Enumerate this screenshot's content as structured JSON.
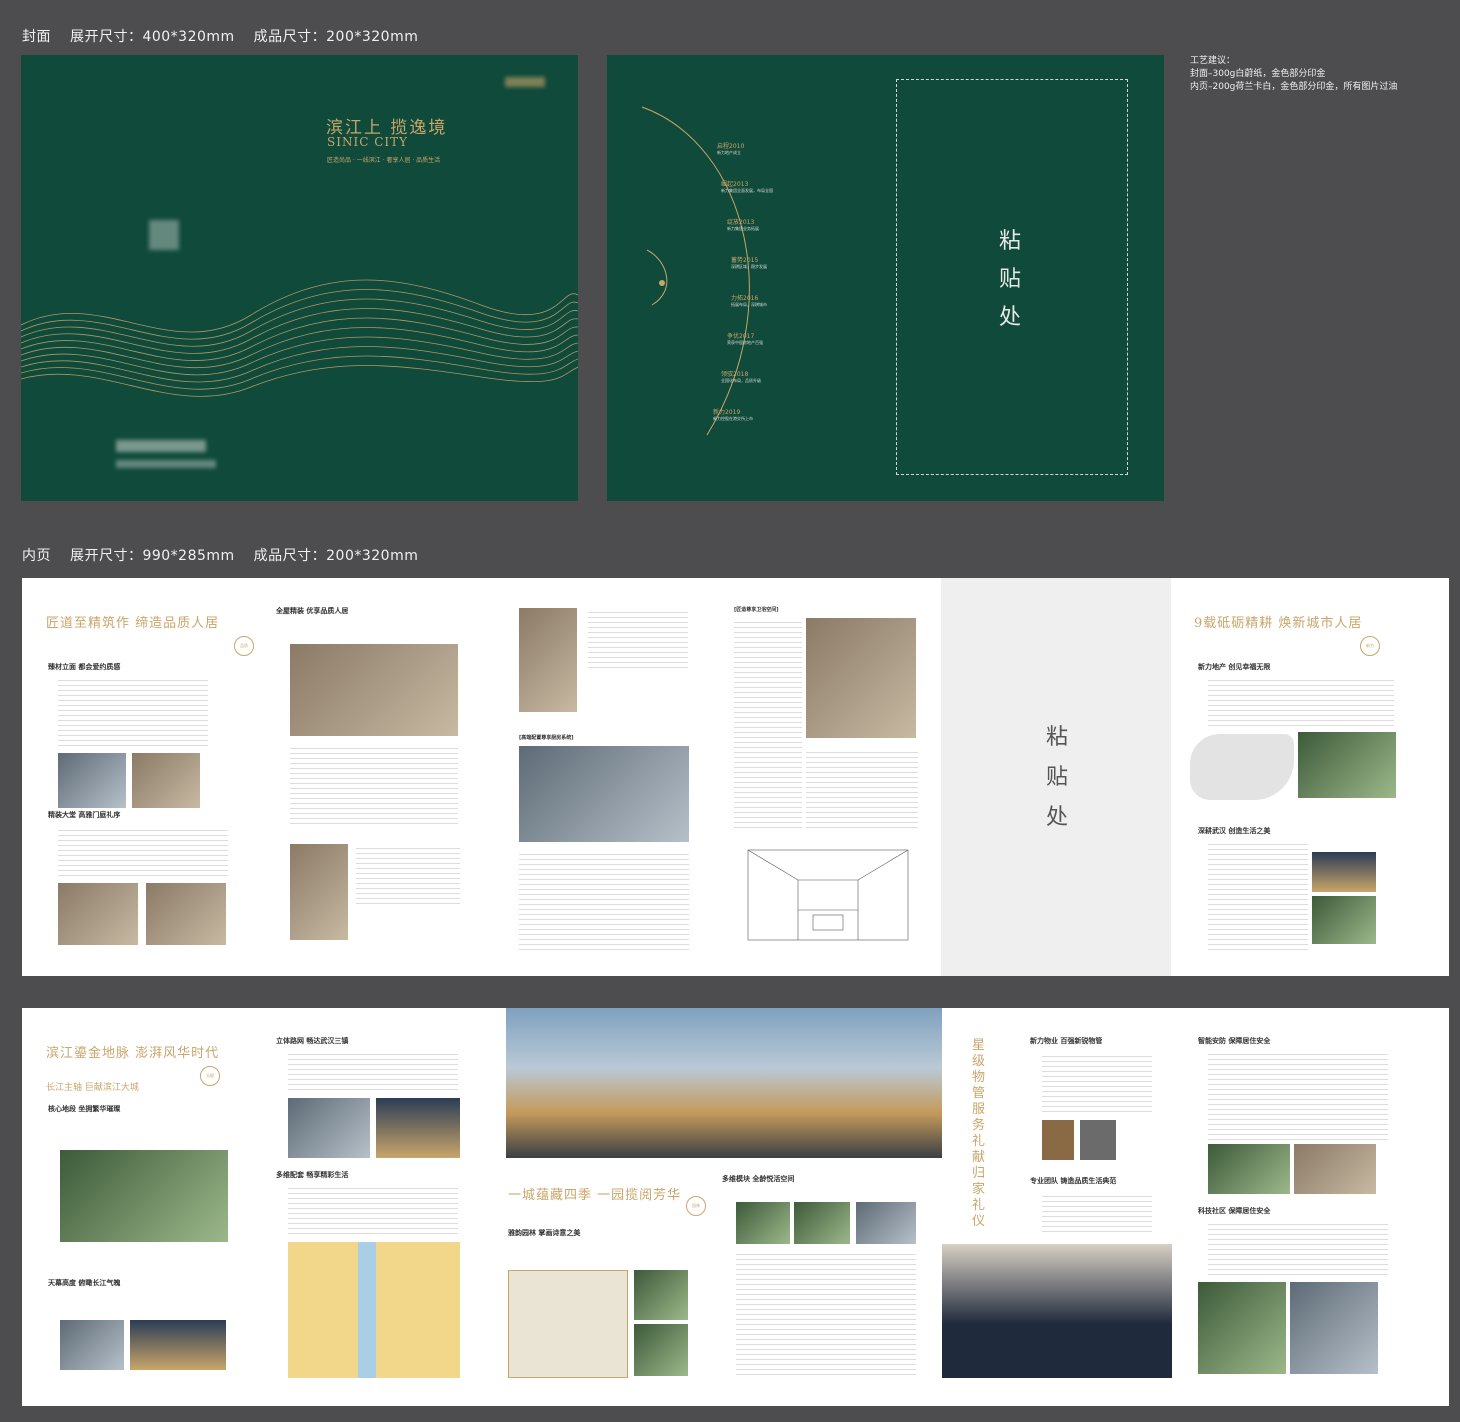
{
  "cover_label": {
    "name": "封面",
    "spread": "展开尺寸：400*320mm",
    "final": "成品尺寸：200*320mm"
  },
  "inner_label": {
    "name": "内页",
    "spread": "展开尺寸：990*285mm",
    "final": "成品尺寸：200*320mm"
  },
  "craft": {
    "title": "工艺建议：",
    "line1": "封面–300g白蔚纸，金色部分印金",
    "line2": "内页–200g荷兰卡白，金色部分印金，所有图片过油"
  },
  "cover": {
    "title": "滨江上 揽逸境",
    "subtitle": "SINIC CITY",
    "tag": "匠造尚品 · 一线滨江 · 奢享人居 · 品质生活"
  },
  "back_cover": {
    "paste": [
      "粘",
      "贴",
      "处"
    ],
    "timeline": [
      {
        "title": "启程2010",
        "desc": "新力地产成立"
      },
      {
        "title": "崛起2013",
        "desc": "新力集团全面发展，布局全国"
      },
      {
        "title": "绽放2013",
        "desc": "新力集团业务拓展"
      },
      {
        "title": "蓄势2015",
        "desc": "深耕区域，稳步发展"
      },
      {
        "title": "力拓2016",
        "desc": "拓展布局，深耕城市"
      },
      {
        "title": "争优2017",
        "desc": "荣获中国房地产百强"
      },
      {
        "title": "领驭2018",
        "desc": "全国化布局，品质升级"
      },
      {
        "title": "新力2019",
        "desc": "新力控股在港交所上市"
      }
    ]
  },
  "inner_top": {
    "p1_title": "匠道至精筑作 缔造品质人居",
    "p1_sec1": "臻材立面 都会爱约质感",
    "p1_sec2": "精装大堂 高雅门庭礼序",
    "p2_sec1": "全屋精装 优享品质人居",
    "p3_sec": "[高端配置尊享厨房系统]",
    "p4_sec": "[匠造尊享卫浴空间]",
    "paste": [
      "粘",
      "贴",
      "处"
    ],
    "p6_title": "9载砥砺精耕 焕新城市人居",
    "p6_sec1": "新力地产 创见幸福无限",
    "p6_sec2": "深耕武汉 创造生活之美"
  },
  "inner_bottom": {
    "p1_title": "滨江鎏金地脉 澎湃风华时代",
    "p1_sub": "长江主轴 巨献滨江大城",
    "p1_sec1": "核心地段 坐拥繁华璀璨",
    "p1_sec2": "天幕高度 俯瞰长江气魄",
    "p2_sec1": "立体路网 畅达武汉三镇",
    "p2_sec2": "多维配套 畅享精彩生活",
    "p3_title": "一城蕴藏四季 一园揽阅芳华",
    "p3_sec": "雅韵园林 掌画诗意之美",
    "p4_sec": "多维模块 全龄悦活空间",
    "p5_title": "星级物管服务 礼献归家礼仪",
    "p5_sec1": "新力物业 百强新锐物管",
    "p5_sec2": "专业团队 铸造品质生活典范",
    "p6_sec1": "智能安防 保障居住安全",
    "p6_sec2": "科技社区 保障居住安全"
  },
  "colors": {
    "green": "#0f4a3a",
    "gold": "#c9a56a",
    "background": "#4d4d4f"
  }
}
